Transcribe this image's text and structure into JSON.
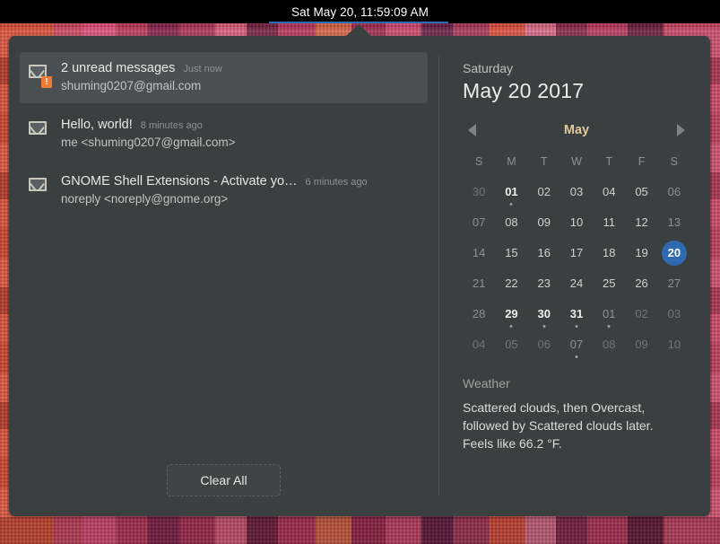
{
  "topbar": {
    "clock": "Sat May 20, 11:59:09 AM",
    "accent_color": "#2a6bb5"
  },
  "notifications": {
    "items": [
      {
        "icon": "envelope-alert-icon",
        "title": "2 unread messages",
        "time": "Just now",
        "sender": "shuming0207@gmail.com",
        "badge": "!",
        "highlighted": true
      },
      {
        "icon": "envelope-icon",
        "title": "Hello, world!",
        "time": "8 minutes ago",
        "sender": "me <shuming0207@gmail.com>",
        "badge": "",
        "highlighted": false
      },
      {
        "icon": "envelope-icon",
        "title": "GNOME Shell Extensions - Activate yo…",
        "time": "6 minutes ago",
        "sender": "noreply <noreply@gnome.org>",
        "badge": "",
        "highlighted": false
      }
    ],
    "clear_all_label": "Clear All"
  },
  "calendar": {
    "weekday": "Saturday",
    "full_date": "May 20 2017",
    "month_label": "May",
    "prev_arrow": "prev-month-arrow",
    "next_arrow": "next-month-arrow",
    "day_headers": [
      "S",
      "M",
      "T",
      "W",
      "T",
      "F",
      "S"
    ],
    "selected_day": "20",
    "selected_color": "#2f6ab0",
    "days": [
      {
        "n": "30",
        "other": true,
        "event": false,
        "weekend": true,
        "selected": false
      },
      {
        "n": "01",
        "other": false,
        "event": true,
        "weekend": false,
        "selected": false
      },
      {
        "n": "02",
        "other": false,
        "event": false,
        "weekend": false,
        "selected": false
      },
      {
        "n": "03",
        "other": false,
        "event": false,
        "weekend": false,
        "selected": false
      },
      {
        "n": "04",
        "other": false,
        "event": false,
        "weekend": false,
        "selected": false
      },
      {
        "n": "05",
        "other": false,
        "event": false,
        "weekend": false,
        "selected": false
      },
      {
        "n": "06",
        "other": false,
        "event": false,
        "weekend": true,
        "selected": false
      },
      {
        "n": "07",
        "other": false,
        "event": false,
        "weekend": true,
        "selected": false
      },
      {
        "n": "08",
        "other": false,
        "event": false,
        "weekend": false,
        "selected": false
      },
      {
        "n": "09",
        "other": false,
        "event": false,
        "weekend": false,
        "selected": false
      },
      {
        "n": "10",
        "other": false,
        "event": false,
        "weekend": false,
        "selected": false
      },
      {
        "n": "11",
        "other": false,
        "event": false,
        "weekend": false,
        "selected": false
      },
      {
        "n": "12",
        "other": false,
        "event": false,
        "weekend": false,
        "selected": false
      },
      {
        "n": "13",
        "other": false,
        "event": false,
        "weekend": true,
        "selected": false
      },
      {
        "n": "14",
        "other": false,
        "event": false,
        "weekend": true,
        "selected": false
      },
      {
        "n": "15",
        "other": false,
        "event": false,
        "weekend": false,
        "selected": false
      },
      {
        "n": "16",
        "other": false,
        "event": false,
        "weekend": false,
        "selected": false
      },
      {
        "n": "17",
        "other": false,
        "event": false,
        "weekend": false,
        "selected": false
      },
      {
        "n": "18",
        "other": false,
        "event": false,
        "weekend": false,
        "selected": false
      },
      {
        "n": "19",
        "other": false,
        "event": false,
        "weekend": false,
        "selected": false
      },
      {
        "n": "20",
        "other": false,
        "event": false,
        "weekend": true,
        "selected": true
      },
      {
        "n": "21",
        "other": false,
        "event": false,
        "weekend": true,
        "selected": false
      },
      {
        "n": "22",
        "other": false,
        "event": false,
        "weekend": false,
        "selected": false
      },
      {
        "n": "23",
        "other": false,
        "event": false,
        "weekend": false,
        "selected": false
      },
      {
        "n": "24",
        "other": false,
        "event": false,
        "weekend": false,
        "selected": false
      },
      {
        "n": "25",
        "other": false,
        "event": false,
        "weekend": false,
        "selected": false
      },
      {
        "n": "26",
        "other": false,
        "event": false,
        "weekend": false,
        "selected": false
      },
      {
        "n": "27",
        "other": false,
        "event": false,
        "weekend": true,
        "selected": false
      },
      {
        "n": "28",
        "other": false,
        "event": false,
        "weekend": true,
        "selected": false
      },
      {
        "n": "29",
        "other": false,
        "event": true,
        "weekend": false,
        "selected": false
      },
      {
        "n": "30",
        "other": false,
        "event": true,
        "weekend": false,
        "selected": false
      },
      {
        "n": "31",
        "other": false,
        "event": true,
        "weekend": false,
        "selected": false
      },
      {
        "n": "01",
        "other": true,
        "event": true,
        "weekend": false,
        "selected": false
      },
      {
        "n": "02",
        "other": true,
        "event": false,
        "weekend": false,
        "selected": false
      },
      {
        "n": "03",
        "other": true,
        "event": false,
        "weekend": true,
        "selected": false
      },
      {
        "n": "04",
        "other": true,
        "event": false,
        "weekend": true,
        "selected": false
      },
      {
        "n": "05",
        "other": true,
        "event": false,
        "weekend": false,
        "selected": false
      },
      {
        "n": "06",
        "other": true,
        "event": false,
        "weekend": false,
        "selected": false
      },
      {
        "n": "07",
        "other": true,
        "event": true,
        "weekend": false,
        "selected": false
      },
      {
        "n": "08",
        "other": true,
        "event": false,
        "weekend": false,
        "selected": false
      },
      {
        "n": "09",
        "other": true,
        "event": false,
        "weekend": false,
        "selected": false
      },
      {
        "n": "10",
        "other": true,
        "event": false,
        "weekend": true,
        "selected": false
      }
    ]
  },
  "weather": {
    "title": "Weather",
    "forecast": "Scattered clouds, then Overcast, followed by Scattered clouds later. Feels like 66.2 °F."
  }
}
